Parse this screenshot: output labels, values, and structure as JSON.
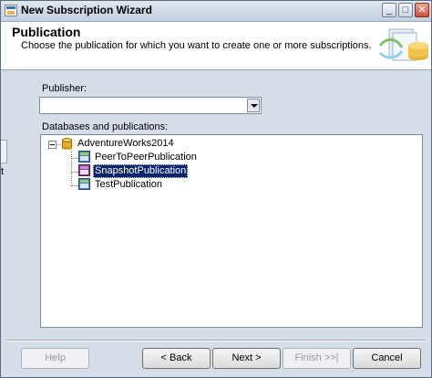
{
  "window": {
    "title": "New Subscription Wizard"
  },
  "header": {
    "title": "Publication",
    "description": "Choose the publication for which you want to create one or more subscriptions."
  },
  "publisher": {
    "label": "Publisher:",
    "value": ""
  },
  "databases": {
    "label": "Databases and publications:",
    "tree": {
      "database": "AdventureWorks2014",
      "publications": [
        "PeerToPeerPublication",
        "SnapshotPublication",
        "TestPublication"
      ],
      "selected": "SnapshotPublication"
    }
  },
  "left_edge": {
    "text": "t"
  },
  "buttons": {
    "help": "Help",
    "back": "< Back",
    "next": "Next >",
    "finish": "Finish >>|",
    "cancel": "Cancel"
  },
  "icons": {
    "app": "wizard-icon",
    "database": "database-icon",
    "publication": "publication-icon"
  }
}
